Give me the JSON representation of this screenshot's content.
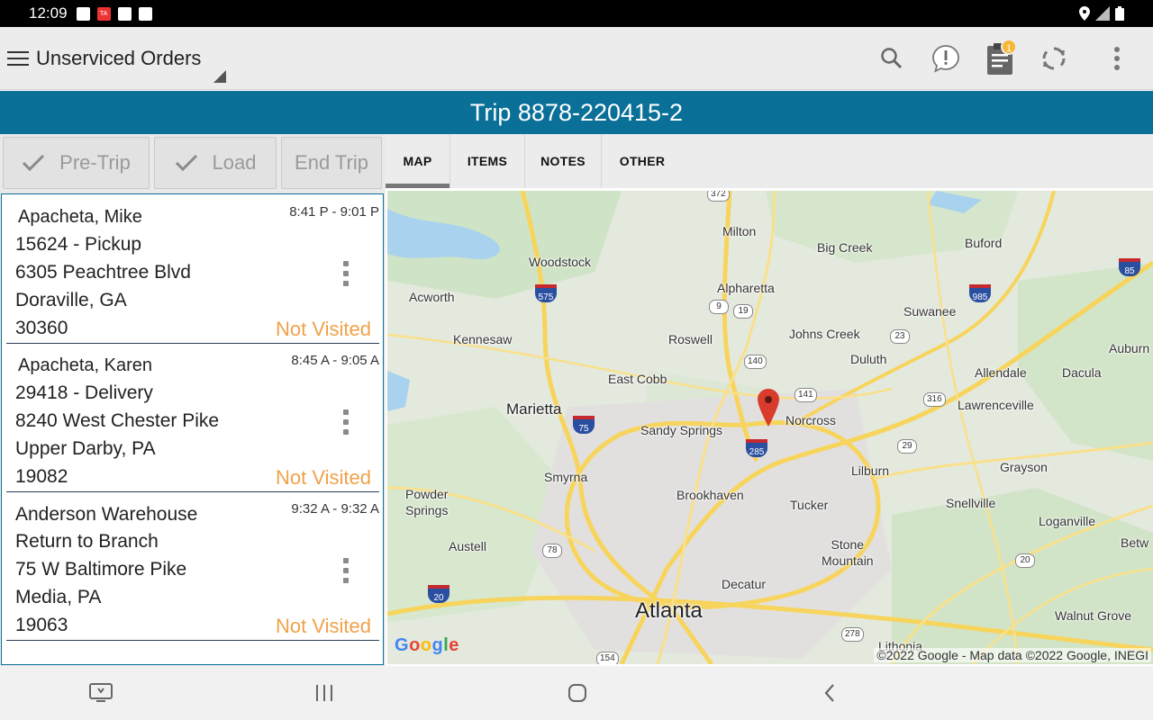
{
  "status_bar": {
    "time": "12:09",
    "icons": [
      "photo-icon",
      "calendar-icon",
      "game-icon",
      "image-icon"
    ],
    "calendar_label": "TA",
    "right_icons": [
      "location-icon",
      "signal-icon",
      "battery-icon"
    ]
  },
  "app_bar": {
    "menu_icon": "hamburger-menu-icon",
    "title": "Unserviced Orders",
    "actions": [
      {
        "name": "search-icon"
      },
      {
        "name": "alert-message-icon"
      },
      {
        "name": "clipboard-icon",
        "badge": "1"
      },
      {
        "name": "sync-icon"
      },
      {
        "name": "overflow-menu-icon"
      }
    ]
  },
  "trip": {
    "title": "Trip 8878-220415-2"
  },
  "trip_buttons": {
    "pre_trip": "Pre-Trip",
    "load": "Load",
    "end_trip": "End Trip"
  },
  "stops": [
    {
      "name": "Apacheta, Mike",
      "order": "15624 - Pickup",
      "street": "6305 Peachtree Blvd",
      "city": "Doraville, GA",
      "zip": "30360",
      "window": "8:41 P - 9:01 P",
      "status": "Not Visited"
    },
    {
      "name": "Apacheta, Karen",
      "order": "29418 - Delivery",
      "street": "8240 West Chester Pike",
      "city": "Upper Darby, PA",
      "zip": "19082",
      "window": "8:45 A - 9:05 A",
      "status": "Not Visited"
    },
    {
      "name": "Anderson Warehouse",
      "order": "Return to Branch",
      "street": "75 W Baltimore Pike",
      "city": "Media, PA",
      "zip": "19063",
      "window": "9:32 A - 9:32 A",
      "status": "Not Visited"
    }
  ],
  "tabs": [
    "MAP",
    "ITEMS",
    "NOTES",
    "OTHER"
  ],
  "map": {
    "labels": {
      "milton": "Milton",
      "big_creek": "Big Creek",
      "buford": "Buford",
      "woodstock": "Woodstock",
      "acworth": "Acworth",
      "alpharetta": "Alpharetta",
      "suwanee": "Suwanee",
      "kennesaw": "Kennesaw",
      "roswell": "Roswell",
      "johns_creek": "Johns Creek",
      "auburn": "Auburn",
      "duluth": "Duluth",
      "allendale": "Allendale",
      "dacula": "Dacula",
      "east_cobb": "East Cobb",
      "marietta": "Marietta",
      "norcross": "Norcross",
      "lawrenceville": "Lawrenceville",
      "sandy_springs": "Sandy Springs",
      "smyrna": "Smyrna",
      "lilburn": "Lilburn",
      "grayson": "Grayson",
      "powder_springs": "Powder\nSprings",
      "brookhaven": "Brookhaven",
      "tucker": "Tucker",
      "snellville": "Snellville",
      "austell": "Austell",
      "loganville": "Loganville",
      "stone_mountain": "Stone\nMountain",
      "betw": "Betw",
      "decatur": "Decatur",
      "atlanta": "Atlanta",
      "walnut_grove": "Walnut Grove",
      "lithonia": "Lithonia"
    },
    "route_shields": [
      "372",
      "9",
      "19",
      "140",
      "141",
      "23",
      "316",
      "29",
      "78",
      "20",
      "278",
      "154"
    ],
    "interstate_shields": [
      "575",
      "985",
      "85",
      "75",
      "285",
      "20"
    ],
    "marker_icon": "map-pin-icon",
    "logo": "Google",
    "copyright": "©2022 Google - Map data ©2022 Google, INEGI"
  },
  "nav_bar": {
    "buttons": [
      "screen-icon",
      "recent-apps-icon",
      "home-icon",
      "back-icon"
    ]
  },
  "colors": {
    "brand": "#0a7098",
    "status_not_visited": "#f0a24a",
    "badge": "#f7b733"
  }
}
